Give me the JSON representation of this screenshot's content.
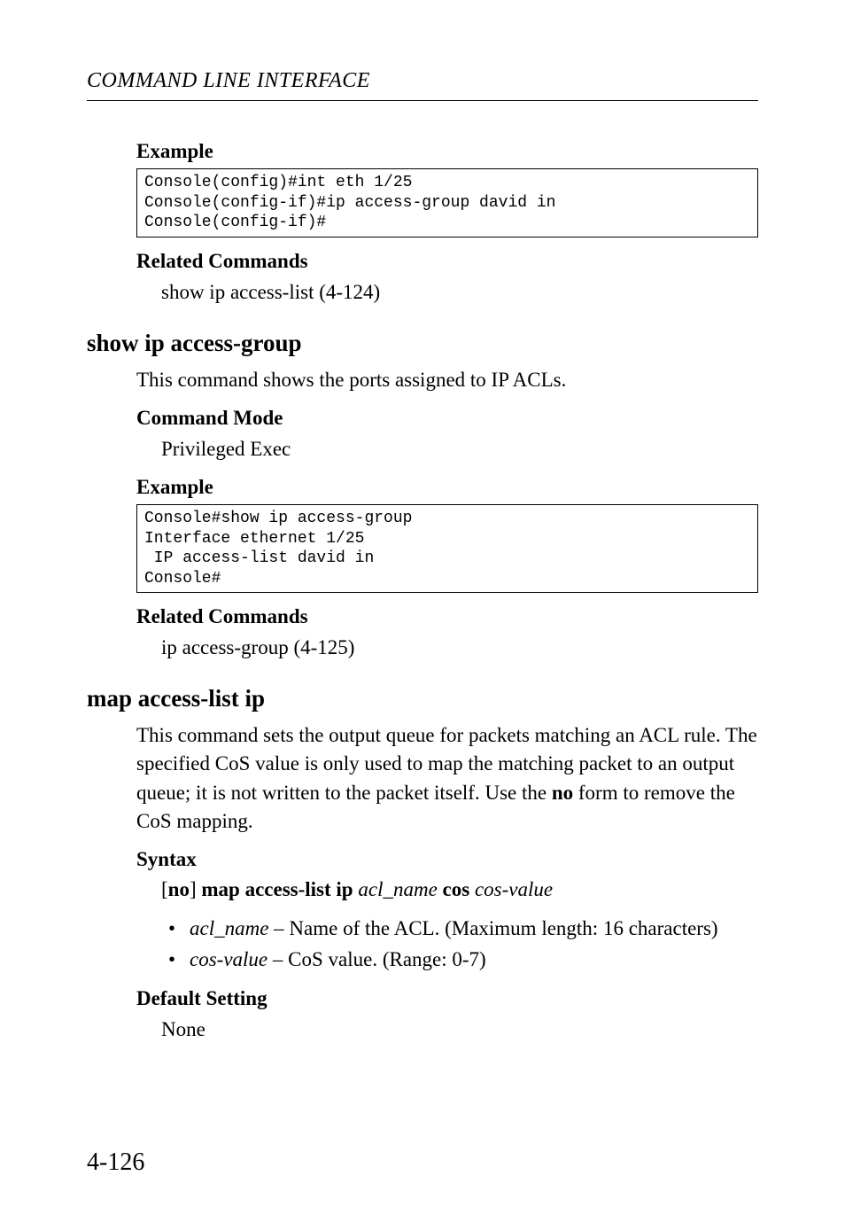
{
  "running_head": "COMMAND LINE INTERFACE",
  "blocks": {
    "ex1_label": "Example",
    "ex1_code": "Console(config)#int eth 1/25\nConsole(config-if)#ip access-group david in\nConsole(config-if)#",
    "rc1_label": "Related Commands",
    "rc1_text": "show ip access-list (4-124)"
  },
  "sec1": {
    "head": "show ip access-group",
    "intro": "This command shows the ports assigned to IP ACLs.",
    "cm_label": "Command Mode",
    "cm_text": "Privileged Exec",
    "ex_label": "Example",
    "ex_code": "Console#show ip access-group\nInterface ethernet 1/25\n IP access-list david in\nConsole#",
    "rc_label": "Related Commands",
    "rc_text": "ip access-group (4-125)"
  },
  "sec2": {
    "head": "map access-list ip",
    "intro_pre": "This command sets the output queue for packets matching an ACL rule. The specified CoS value is only used to map the matching packet to an output queue; it is not written to the packet itself. Use the ",
    "intro_bold": "no",
    "intro_post": " form to remove the CoS mapping.",
    "syntax_label": "Syntax",
    "syntax_p1": "[",
    "syntax_p2": "no",
    "syntax_p3": "] ",
    "syntax_p4": "map access-list ip",
    "syntax_p5": " ",
    "syntax_p6": "acl_name",
    "syntax_p7": " ",
    "syntax_p8": "cos",
    "syntax_p9": " ",
    "syntax_p10": "cos-value",
    "bullet1_it": "acl_name",
    "bullet1_rest": " – Name of the ACL. (Maximum length: 16 characters)",
    "bullet2_it": "cos-value",
    "bullet2_rest": " – CoS value. (Range: 0-7)",
    "def_label": "Default Setting",
    "def_text": "None"
  },
  "page_no": "4-126"
}
